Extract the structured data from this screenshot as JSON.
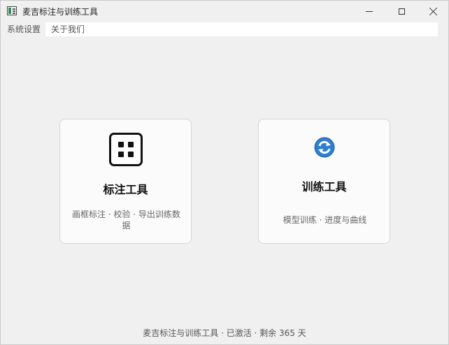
{
  "window": {
    "title": "麦吉标注与训练工具",
    "controls": [
      "minimize",
      "maximize",
      "close"
    ]
  },
  "menubar": {
    "items": [
      {
        "label": "系统设置"
      },
      {
        "label": "关于我们"
      }
    ]
  },
  "cards": [
    {
      "title": "标注工具",
      "description": "画框标注 · 校验 · 导出训练数据",
      "icon": "grid-icon"
    },
    {
      "title": "训练工具",
      "description": "模型训练 · 进度与曲线",
      "icon": "sync-icon"
    }
  ],
  "footer": {
    "status": "麦吉标注与训练工具 · 已激活 · 剩余 365 天"
  },
  "colors": {
    "background": "#f0f0f0",
    "card_background": "#fbfbfb",
    "card_border": "#d6d6d6",
    "sync_icon_blue": "#2f7fd1"
  }
}
